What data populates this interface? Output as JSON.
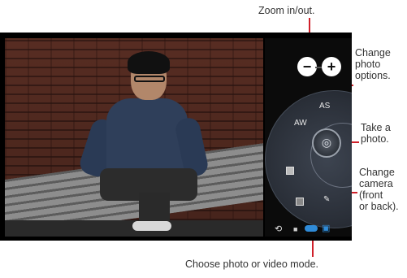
{
  "callouts": {
    "zoom": "Zoom in/out.",
    "photo_options": [
      "Change",
      "photo",
      "options."
    ],
    "take_photo": [
      "Take a",
      "photo."
    ],
    "change_camera": [
      "Change",
      "camera",
      "(front",
      "or back)."
    ],
    "mode": "Choose photo or video mode."
  },
  "controls": {
    "zoom_out": "−",
    "zoom_in": "+",
    "shutter_glyph": "◎",
    "hdr_label": "AW",
    "scene_label": "AS",
    "camera_switch_glyph": "⟲",
    "video_glyph": "■",
    "photo_glyph": "▣"
  },
  "colors": {
    "callout_line": "#d0202a",
    "accent": "#2f8bd8"
  }
}
